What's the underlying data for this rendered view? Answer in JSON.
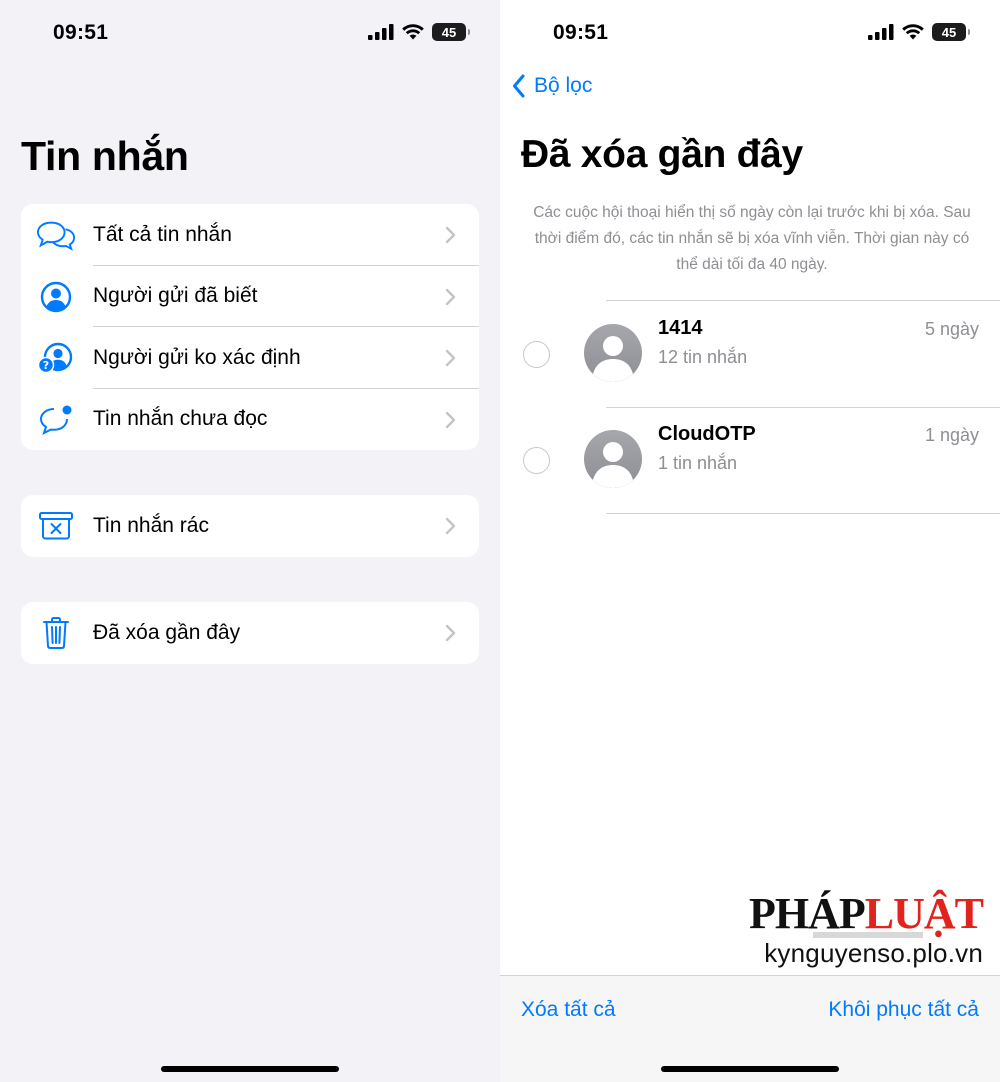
{
  "left": {
    "status": {
      "time": "09:51",
      "battery": "45"
    },
    "title": "Tin nhắn",
    "filters": [
      {
        "label": "Tất cả tin nhắn",
        "icon": "chat-bubbles-icon"
      },
      {
        "label": "Người gửi đã biết",
        "icon": "person-circle-icon"
      },
      {
        "label": "Người gửi ko xác định",
        "icon": "unknown-person-icon"
      },
      {
        "label": "Tin nhắn chưa đọc",
        "icon": "unread-bubble-icon"
      }
    ],
    "junk": {
      "label": "Tin nhắn rác",
      "icon": "junk-bin-icon"
    },
    "recently_deleted": {
      "label": "Đã xóa gần đây",
      "icon": "trash-icon"
    }
  },
  "right": {
    "status": {
      "time": "09:51",
      "battery": "45"
    },
    "back_label": "Bộ lọc",
    "title": "Đã xóa gần đây",
    "description": "Các cuộc hội thoại hiển thị số ngày còn lại trước khi bị xóa. Sau thời điểm đó, các tin nhắn sẽ bị xóa vĩnh viễn. Thời gian này có thể dài tối đa 40 ngày.",
    "conversations": [
      {
        "name": "1414",
        "count": "12 tin nhắn",
        "time": "5 ngày"
      },
      {
        "name": "CloudOTP",
        "count": "1 tin nhắn",
        "time": "1 ngày"
      }
    ],
    "watermark": {
      "logo_a": "PHÁP",
      "logo_b": "LUẬT",
      "site": "kynguyenso.plo.vn"
    },
    "delete_all": "Xóa tất cả",
    "restore_all": "Khôi phục tất cả"
  },
  "colors": {
    "accent": "#007aff",
    "secondary_text": "#8e8e93",
    "grouped_bg": "#f2f2f7",
    "watermark_red": "#e0231c"
  }
}
